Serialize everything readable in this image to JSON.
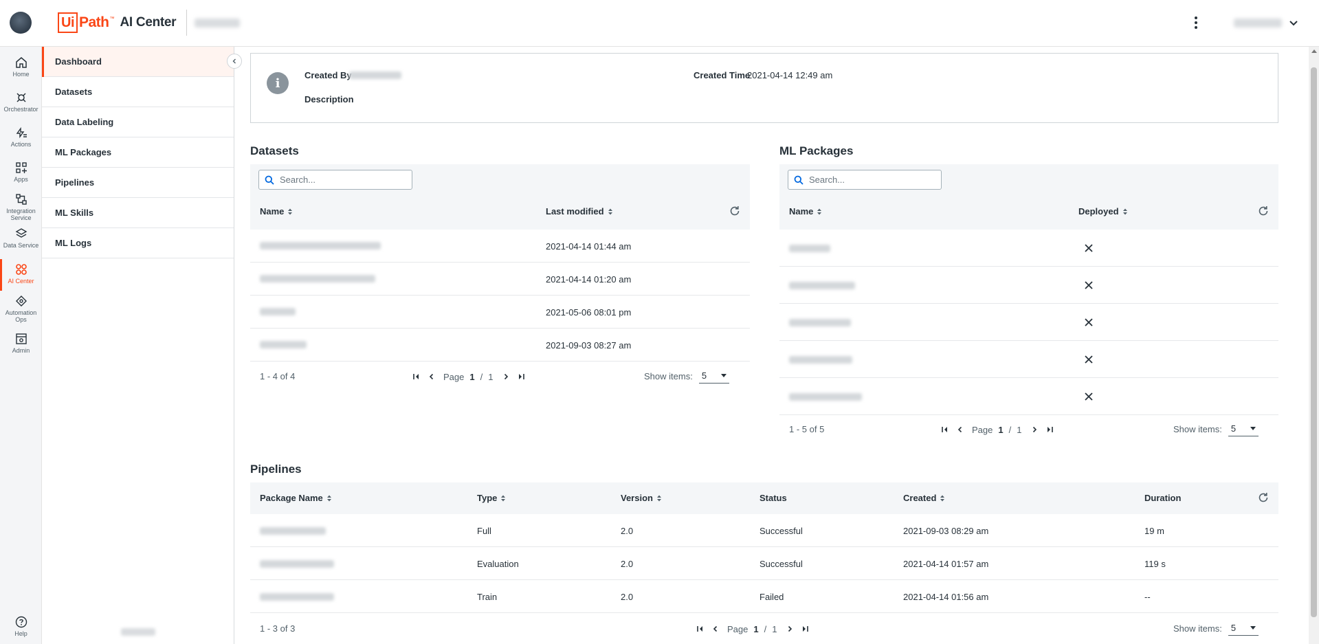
{
  "header": {
    "logo_ui": "Ui",
    "logo_path": "Path",
    "logo_tm": "™",
    "product": "AI Center"
  },
  "rail": [
    {
      "label": "Home",
      "icon": "home-icon"
    },
    {
      "label": "Orchestrator",
      "icon": "orchestrator-icon"
    },
    {
      "label": "Actions",
      "icon": "actions-icon"
    },
    {
      "label": "Apps",
      "icon": "apps-icon"
    },
    {
      "label": "Integration Service",
      "icon": "integration-icon"
    },
    {
      "label": "Data Service",
      "icon": "data-service-icon"
    },
    {
      "label": "AI Center",
      "icon": "ai-center-icon",
      "active": true
    },
    {
      "label": "Automation Ops",
      "icon": "automation-ops-icon"
    },
    {
      "label": "Admin",
      "icon": "admin-icon"
    }
  ],
  "rail_help": "Help",
  "subnav": [
    "Dashboard",
    "Datasets",
    "Data Labeling",
    "ML Packages",
    "Pipelines",
    "ML Skills",
    "ML Logs"
  ],
  "info": {
    "created_by_label": "Created By",
    "created_time_label": "Created Time",
    "created_time_value": "2021-04-14 12:49 am",
    "description_label": "Description"
  },
  "datasets": {
    "title": "Datasets",
    "search_placeholder": "Search...",
    "col_name": "Name",
    "col_modified": "Last modified",
    "rows": [
      {
        "modified": "2021-04-14 01:44 am"
      },
      {
        "modified": "2021-04-14 01:20 am"
      },
      {
        "modified": "2021-05-06 08:01 pm"
      },
      {
        "modified": "2021-09-03 08:27 am"
      }
    ],
    "range": "1 - 4 of 4",
    "page_word": "Page",
    "page_current": "1",
    "page_sep": "/",
    "page_total": "1",
    "show_items_label": "Show items:",
    "show_items_value": "5"
  },
  "ml_packages": {
    "title": "ML Packages",
    "search_placeholder": "Search...",
    "col_name": "Name",
    "col_deployed": "Deployed",
    "row_count": 5,
    "range": "1 - 5 of 5",
    "page_word": "Page",
    "page_current": "1",
    "page_sep": "/",
    "page_total": "1",
    "show_items_label": "Show items:",
    "show_items_value": "5"
  },
  "pipelines": {
    "title": "Pipelines",
    "col_package": "Package Name",
    "col_type": "Type",
    "col_version": "Version",
    "col_status": "Status",
    "col_created": "Created",
    "col_duration": "Duration",
    "rows": [
      {
        "type": "Full",
        "version": "2.0",
        "status": "Successful",
        "created": "2021-09-03 08:29 am",
        "duration": "19 m"
      },
      {
        "type": "Evaluation",
        "version": "2.0",
        "status": "Successful",
        "created": "2021-04-14 01:57 am",
        "duration": "119 s"
      },
      {
        "type": "Train",
        "version": "2.0",
        "status": "Failed",
        "created": "2021-04-14 01:56 am",
        "duration": "--"
      }
    ],
    "range": "1 - 3 of 3",
    "page_word": "Page",
    "page_current": "1",
    "page_sep": "/",
    "page_total": "1",
    "show_items_label": "Show items:",
    "show_items_value": "5"
  },
  "colors": {
    "accent": "#fa4616",
    "text": "#273139",
    "muted": "#526069",
    "band": "#f4f6f8"
  }
}
